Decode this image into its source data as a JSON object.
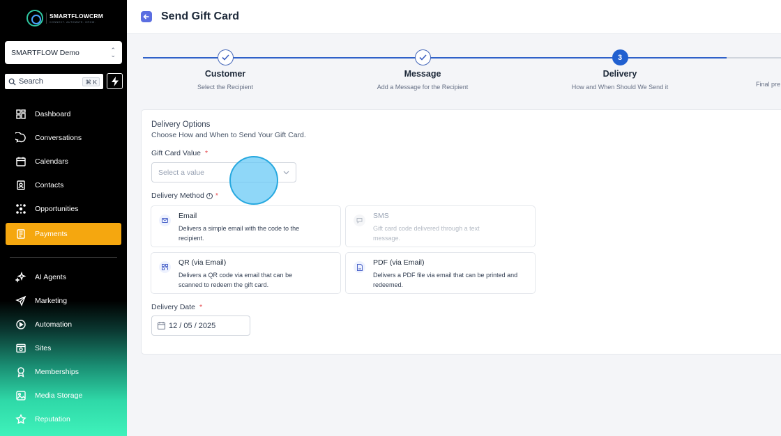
{
  "brand": {
    "name": "SMARTFLOWCRM",
    "tagline": "CONNECT. AUTOMATE. GROW."
  },
  "account": {
    "name": "SMARTFLOW Demo"
  },
  "search": {
    "label": "Search",
    "shortcut": "⌘ K"
  },
  "nav": {
    "items": [
      {
        "label": "Dashboard",
        "icon": "dashboard-icon"
      },
      {
        "label": "Conversations",
        "icon": "chat-bubble-icon"
      },
      {
        "label": "Calendars",
        "icon": "calendar-icon"
      },
      {
        "label": "Contacts",
        "icon": "contacts-icon"
      },
      {
        "label": "Opportunities",
        "icon": "opportunities-icon"
      },
      {
        "label": "Payments",
        "icon": "payments-icon",
        "active": true
      },
      {
        "label": "AI Agents",
        "icon": "sparkle-icon"
      },
      {
        "label": "Marketing",
        "icon": "send-icon"
      },
      {
        "label": "Automation",
        "icon": "automation-icon"
      },
      {
        "label": "Sites",
        "icon": "sites-icon"
      },
      {
        "label": "Memberships",
        "icon": "award-icon"
      },
      {
        "label": "Media Storage",
        "icon": "image-icon"
      },
      {
        "label": "Reputation",
        "icon": "star-icon"
      }
    ]
  },
  "header": {
    "title": "Send Gift Card"
  },
  "steps": [
    {
      "title": "Customer",
      "subtitle": "Select the Recipient",
      "status": "complete"
    },
    {
      "title": "Message",
      "subtitle": "Add a Message for the Recipient",
      "status": "complete"
    },
    {
      "title": "Delivery",
      "subtitle": "How and When Should We Send it",
      "status": "current",
      "number": "3"
    },
    {
      "title": "",
      "subtitle": "Final pre",
      "status": "upcoming"
    }
  ],
  "delivery": {
    "section_title": "Delivery Options",
    "section_subtitle": "Choose How and When to Send Your Gift Card.",
    "gift_value_label": "Gift Card Value",
    "gift_value_placeholder": "Select a value",
    "method_label": "Delivery Method",
    "required_mark": "*",
    "methods": [
      {
        "title": "Email",
        "description": "Delivers a simple email with the code to the recipient.",
        "icon": "mail-icon",
        "enabled": true
      },
      {
        "title": "SMS",
        "description": "Gift card code delivered through a text message.",
        "icon": "sms-icon",
        "enabled": false
      },
      {
        "title": "QR (via Email)",
        "description": "Delivers a QR code via email that can be scanned to redeem the gift card.",
        "icon": "qr-code-icon",
        "enabled": true
      },
      {
        "title": "PDF (via Email)",
        "description": "Delivers a PDF file via email that can be printed and redeemed.",
        "icon": "pdf-file-icon",
        "enabled": true
      }
    ],
    "date_label": "Delivery Date",
    "date_value": "12 / 05 / 2025"
  },
  "colors": {
    "accent": "#2160d0",
    "active_nav": "#f5a70f",
    "back_button": "#5b6ee1",
    "required": "#e5484d"
  }
}
